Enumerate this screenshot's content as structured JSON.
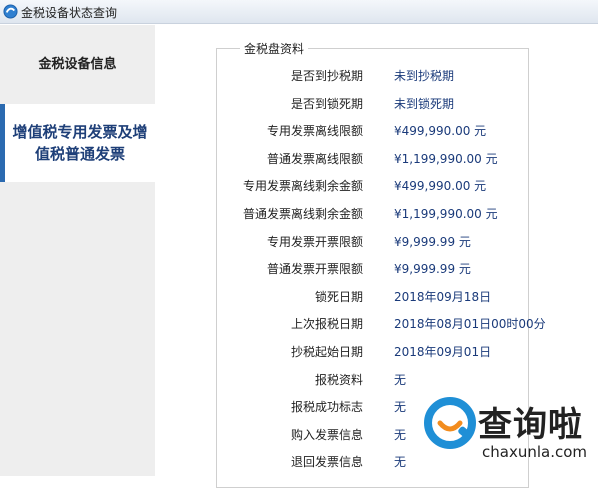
{
  "window": {
    "title": "金税设备状态查询",
    "icon": "app-icon"
  },
  "sidebar": {
    "items": [
      {
        "label": "金税设备信息",
        "selected": false
      },
      {
        "label": "增值税专用发票及增值税普通发票",
        "selected": true
      }
    ]
  },
  "panel": {
    "legend": "金税盘资料",
    "rows": [
      {
        "label": "是否到抄税期",
        "value": "未到抄税期"
      },
      {
        "label": "是否到锁死期",
        "value": "未到锁死期"
      },
      {
        "label": "专用发票离线限额",
        "value": "¥499,990.00 元"
      },
      {
        "label": "普通发票离线限额",
        "value": "¥1,199,990.00 元"
      },
      {
        "label": "专用发票离线剩余金额",
        "value": "¥499,990.00 元"
      },
      {
        "label": "普通发票离线剩余金额",
        "value": "¥1,199,990.00 元"
      },
      {
        "label": "专用发票开票限额",
        "value": "¥9,999.99 元"
      },
      {
        "label": "普通发票开票限额",
        "value": "¥9,999.99 元"
      },
      {
        "label": "锁死日期",
        "value": "2018年09月18日"
      },
      {
        "label": "上次报税日期",
        "value": "2018年08月01日00时00分"
      },
      {
        "label": "抄税起始日期",
        "value": "2018年09月01日"
      },
      {
        "label": "报税资料",
        "value": "无"
      },
      {
        "label": "报税成功标志",
        "value": "无"
      },
      {
        "label": "购入发票信息",
        "value": "无"
      },
      {
        "label": "退回发票信息",
        "value": "无"
      }
    ]
  },
  "watermark": {
    "cn": "查询啦",
    "en": "chaxunla.com",
    "icon": "chaxunla-logo-icon",
    "brand_color": "#1f8fd6"
  },
  "colors": {
    "accent": "#2b6ab0",
    "value_text": "#1a3a7a",
    "sidebar_bg": "#eeeeee"
  }
}
